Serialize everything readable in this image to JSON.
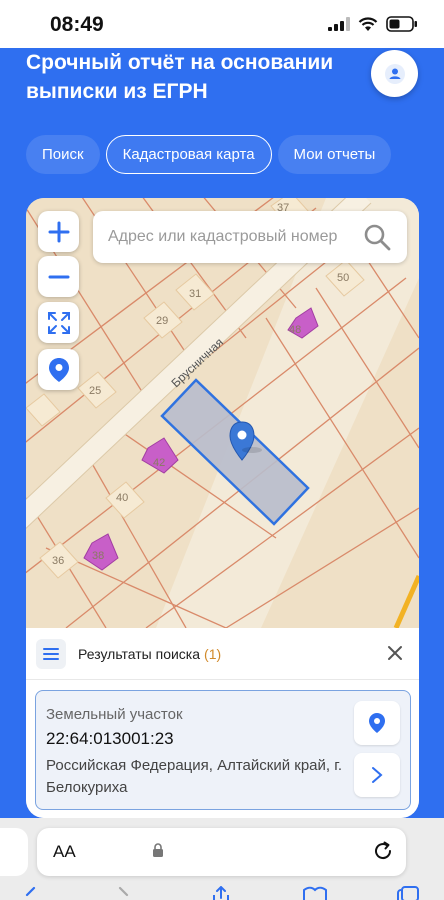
{
  "status_bar": {
    "time": "08:49"
  },
  "header": {
    "title": "Срочный отчёт на основании выписки из ЕГРН"
  },
  "tabs": [
    {
      "label": "Поиск",
      "active": false
    },
    {
      "label": "Кадастровая карта",
      "active": true
    },
    {
      "label": "Мои отчеты",
      "active": false
    }
  ],
  "map": {
    "search_placeholder": "Адрес или кадастровый номер",
    "street_label": "Брусничная",
    "parcel_numbers": [
      "37",
      "50",
      "31",
      "29",
      "48",
      "25",
      "42",
      "40",
      "36",
      "38"
    ]
  },
  "results": {
    "title": "Результаты поиска",
    "count": "(1)",
    "items": [
      {
        "type": "Земельный участок",
        "cadastral_number": "22:64:013001:23",
        "address": "Российская Федерация, Алтайский край, г. Белокуриха"
      }
    ]
  },
  "browser": {
    "text_size_label": "AA"
  },
  "colors": {
    "brand_blue": "#2f6ff0",
    "selected_parcel": "#4a7fd6",
    "building": "#c85fc8",
    "parcel_line": "#d98a6a",
    "accent_orange": "#d18a2b"
  }
}
